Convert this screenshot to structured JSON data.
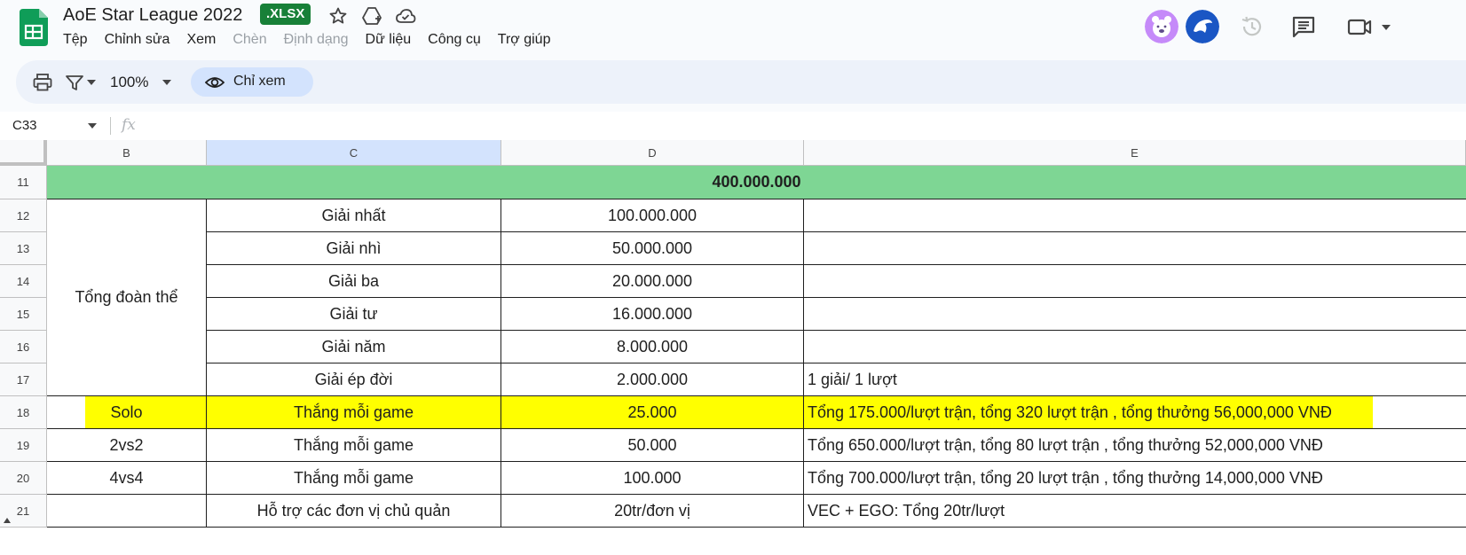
{
  "app": {
    "title": "AoE Star League 2022",
    "file_badge": ".XLSX",
    "brand_color": "#188038"
  },
  "menu": {
    "items": [
      {
        "label": "Tệp",
        "disabled": false
      },
      {
        "label": "Chỉnh sửa",
        "disabled": false
      },
      {
        "label": "Xem",
        "disabled": false
      },
      {
        "label": "Chèn",
        "disabled": true
      },
      {
        "label": "Định dạng",
        "disabled": true
      },
      {
        "label": "Dữ liệu",
        "disabled": false
      },
      {
        "label": "Công cụ",
        "disabled": false
      },
      {
        "label": "Trợ giúp",
        "disabled": false
      }
    ]
  },
  "toolbar": {
    "zoom": "100%",
    "view_mode_label": "Chỉ xem"
  },
  "formula_bar": {
    "cell_ref": "C33",
    "fx": "fx"
  },
  "grid": {
    "columns": [
      "B",
      "C",
      "D",
      "E"
    ],
    "selected_column": "C",
    "rows": [
      "11",
      "12",
      "13",
      "14",
      "15",
      "16",
      "17",
      "18",
      "19",
      "20",
      "21"
    ],
    "total_row": "400.000.000",
    "group_label": "Tổng đoàn thể",
    "prizes": [
      {
        "name": "Giải nhất",
        "amount": "100.000.000",
        "note": ""
      },
      {
        "name": "Giải nhì",
        "amount": "50.000.000",
        "note": ""
      },
      {
        "name": "Giải ba",
        "amount": "20.000.000",
        "note": ""
      },
      {
        "name": "Giải tư",
        "amount": "16.000.000",
        "note": ""
      },
      {
        "name": "Giải năm",
        "amount": "8.000.000",
        "note": ""
      },
      {
        "name": "Giải ép đời",
        "amount": "2.000.000",
        "note": "1 giải/ 1 lượt"
      }
    ],
    "games": [
      {
        "mode": "Solo",
        "desc": "Thắng mỗi game",
        "amount": "25.000",
        "note": "Tổng 175.000/lượt trận, tổng 320 lượt trận , tổng thưởng 56,000,000 VNĐ",
        "highlight": true
      },
      {
        "mode": "2vs2",
        "desc": "Thắng mỗi game",
        "amount": "50.000",
        "note": "Tổng 650.000/lượt trận, tổng 80 lượt trận , tổng thưởng 52,000,000 VNĐ",
        "highlight": false
      },
      {
        "mode": "4vs4",
        "desc": "Thắng mỗi game",
        "amount": "100.000",
        "note": "Tổng 700.000/lượt trận, tổng 20 lượt trận , tổng thưởng 14,000,000 VNĐ",
        "highlight": false
      }
    ],
    "support": {
      "mode": "",
      "desc": "Hỗ trợ các đơn vị chủ quản",
      "amount": "20tr/đơn vị",
      "note": "VEC + EGO: Tổng 20tr/lượt"
    },
    "colors": {
      "total_row": "#7ed694",
      "highlight": "#ffff00",
      "selected_header": "#d3e3fd"
    }
  }
}
